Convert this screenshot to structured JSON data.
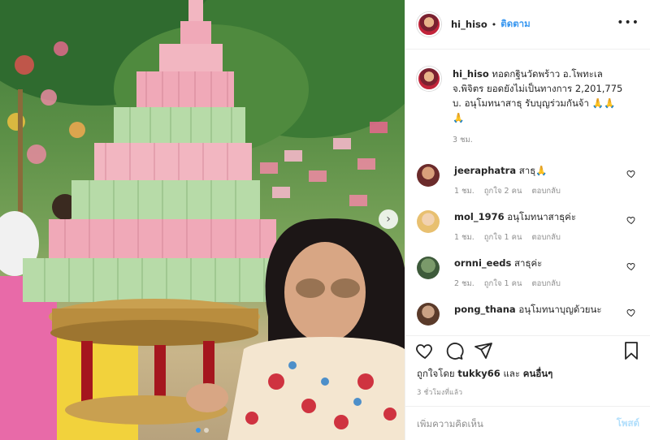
{
  "post": {
    "username": "hi_hiso",
    "separator": "•",
    "follow_label": "ติดตาม",
    "more_label": "•••",
    "caption_line1": "ทอดกฐินวัดพร้าว อ.โพทะเล",
    "caption_line2": "จ.พิจิตร ยอดยังไม่เป็นทางการ 2,201,775",
    "caption_line3": "บ. อนุโมทนาสาธุ รับบุญร่วมกันจ้า 🙏🙏",
    "caption_line4": "🙏",
    "caption_time": "3 ชม."
  },
  "comments": [
    {
      "username": "jeeraphatra",
      "text": "สาธุ🙏",
      "time": "1 ชม.",
      "likes": "ถูกใจ 2 คน",
      "reply": "ตอบกลับ"
    },
    {
      "username": "mol_1976",
      "text": "อนุโมทนาสาธุค่ะ",
      "time": "1 ชม.",
      "likes": "ถูกใจ 1 คน",
      "reply": "ตอบกลับ"
    },
    {
      "username": "ornni_eeds",
      "text": "สาธุค่ะ",
      "time": "2 ชม.",
      "likes": "ถูกใจ 1 คน",
      "reply": "ตอบกลับ"
    },
    {
      "username": "pong_thana",
      "text": "อนุโมทนาบุญด้วยนะ",
      "time": "",
      "likes": "",
      "reply": ""
    }
  ],
  "likes": {
    "prefix": "ถูกใจโดย",
    "user": "tukky66",
    "middle": "และ",
    "others": "คนอื่นๆ"
  },
  "posted_time": "3 ชั่วโมงที่แล้ว",
  "add_comment": {
    "placeholder": "เพิ่มความคิดเห็น",
    "post_label": "โพสต์"
  },
  "carousel": {
    "next_label": "›",
    "slide_count": 2,
    "active_index": 0
  },
  "colors": {
    "link_blue": "#3897f0",
    "disabled_blue": "#b2dffc",
    "meta_gray": "#8e8e8e",
    "border": "#efefef"
  },
  "icons": [
    "heart-icon",
    "comment-icon",
    "share-icon",
    "bookmark-icon",
    "more-icon",
    "carousel-next-icon"
  ]
}
